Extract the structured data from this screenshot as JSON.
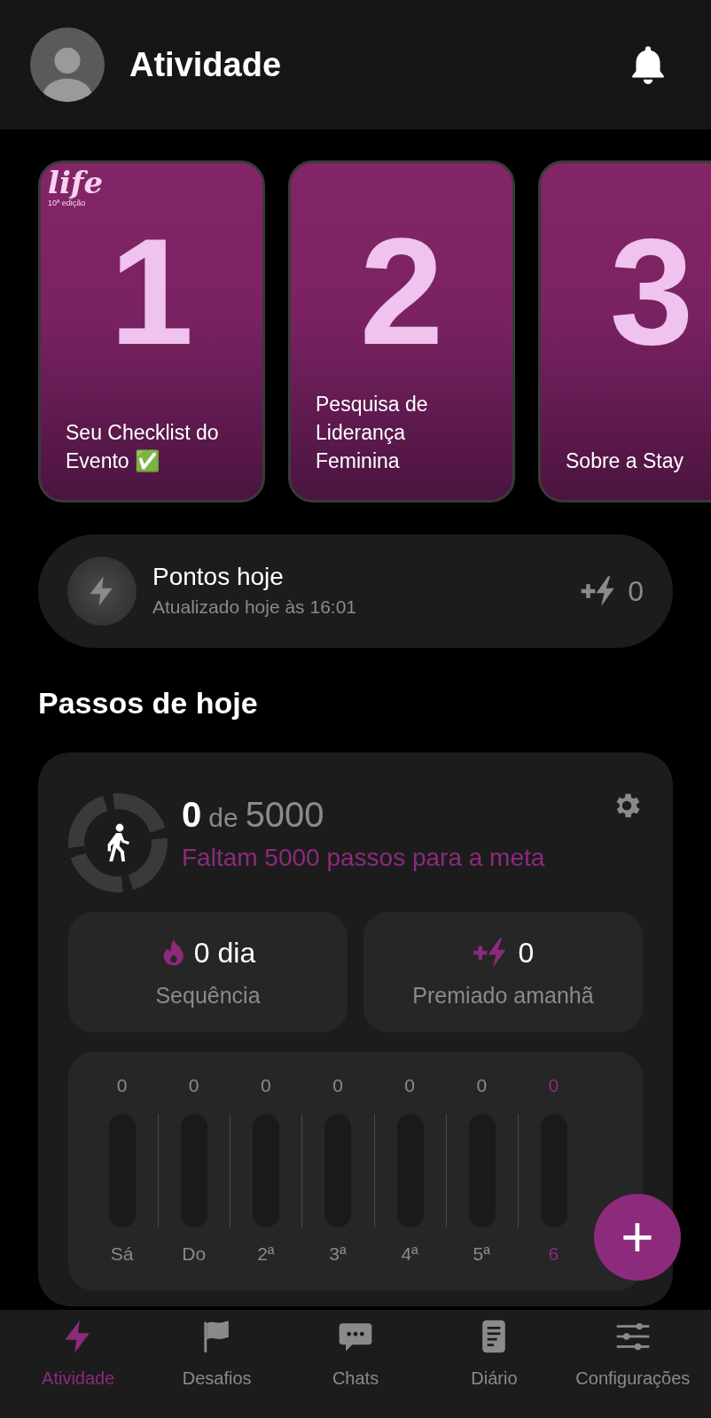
{
  "header": {
    "title": "Atividade"
  },
  "stories": [
    {
      "number": "1",
      "caption": "Seu Checklist do Evento ✅",
      "logo": {
        "name": "life",
        "edition": "10ª edição"
      }
    },
    {
      "number": "2",
      "caption": "Pesquisa de Liderança Feminina"
    },
    {
      "number": "3",
      "caption": "Sobre a Stay"
    }
  ],
  "points": {
    "title": "Pontos hoje",
    "updated": "Atualizado hoje às 16:01",
    "value": "0"
  },
  "steps": {
    "title": "Passos de hoje",
    "count": "0",
    "of": "de",
    "goal": "5000",
    "remaining": "Faltam 5000 passos para a meta",
    "stats": [
      {
        "kind": "streak",
        "value": "0 dia",
        "label": "Sequência"
      },
      {
        "kind": "reward",
        "value": "0",
        "label": "Premiado amanhã"
      }
    ],
    "days": [
      {
        "value": "0",
        "label": "Sá",
        "selected": false
      },
      {
        "value": "0",
        "label": "Do",
        "selected": false
      },
      {
        "value": "0",
        "label": "2ª",
        "selected": false
      },
      {
        "value": "0",
        "label": "3ª",
        "selected": false
      },
      {
        "value": "0",
        "label": "4ª",
        "selected": false
      },
      {
        "value": "0",
        "label": "5ª",
        "selected": false
      },
      {
        "value": "0",
        "label": "6",
        "selected": true
      }
    ]
  },
  "fab": {
    "label": "+"
  },
  "nav": [
    {
      "kind": "activity",
      "label": "Atividade",
      "selected": true
    },
    {
      "kind": "challenges",
      "label": "Desafios",
      "selected": false
    },
    {
      "kind": "chats",
      "label": "Chats",
      "selected": false
    },
    {
      "kind": "journal",
      "label": "Diário",
      "selected": false
    },
    {
      "kind": "settings",
      "label": "Configurações",
      "selected": false
    }
  ]
}
